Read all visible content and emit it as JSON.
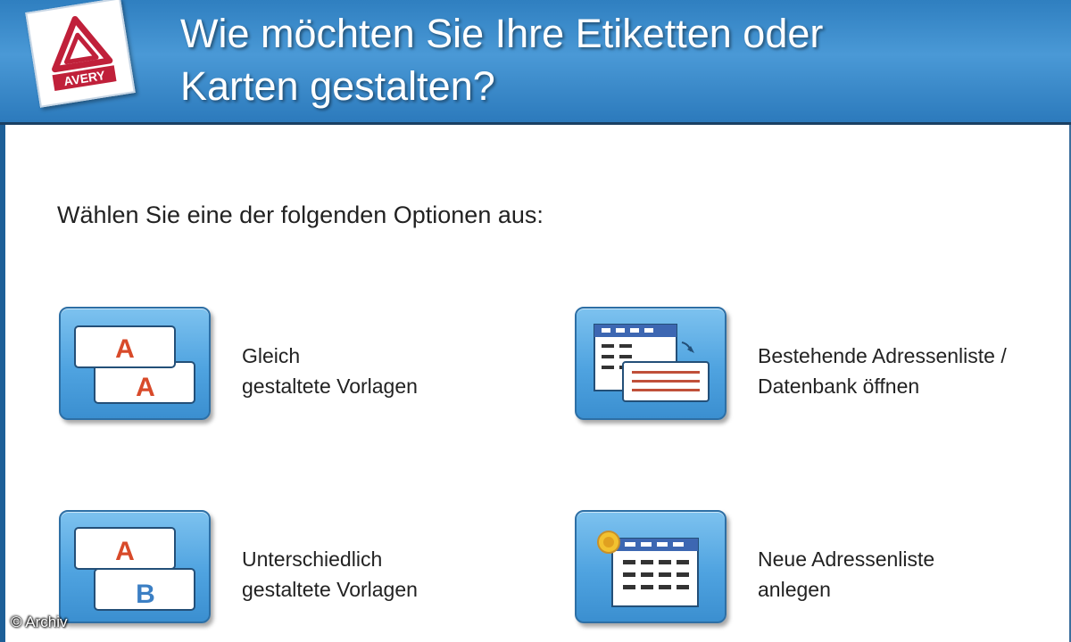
{
  "header": {
    "brand": "AVERY",
    "title_line1": "Wie möchten Sie Ihre Etiketten oder",
    "title_line2": "Karten gestalten?"
  },
  "subtitle": "Wählen Sie eine der folgenden Optionen aus:",
  "options": [
    {
      "line1": "Gleich",
      "line2": "gestaltete Vorlagen",
      "icon": "same-labels-icon"
    },
    {
      "line1": "Bestehende Adressenliste /",
      "line2": "Datenbank öffnen",
      "icon": "open-address-list-icon"
    },
    {
      "line1": "Unterschiedlich",
      "line2": "gestaltete Vorlagen",
      "icon": "different-labels-icon"
    },
    {
      "line1": "Neue Adressenliste",
      "line2": "anlegen",
      "icon": "new-address-list-icon"
    }
  ],
  "icon_glyphs": {
    "letter_a": "A",
    "letter_b": "B"
  },
  "watermark": "© Archiv",
  "colors": {
    "header_blue": "#2f7fc0",
    "button_blue": "#4fa3e0",
    "avery_red": "#c0203a",
    "letter_red": "#d84a2a",
    "letter_blue": "#3b7fc4"
  }
}
